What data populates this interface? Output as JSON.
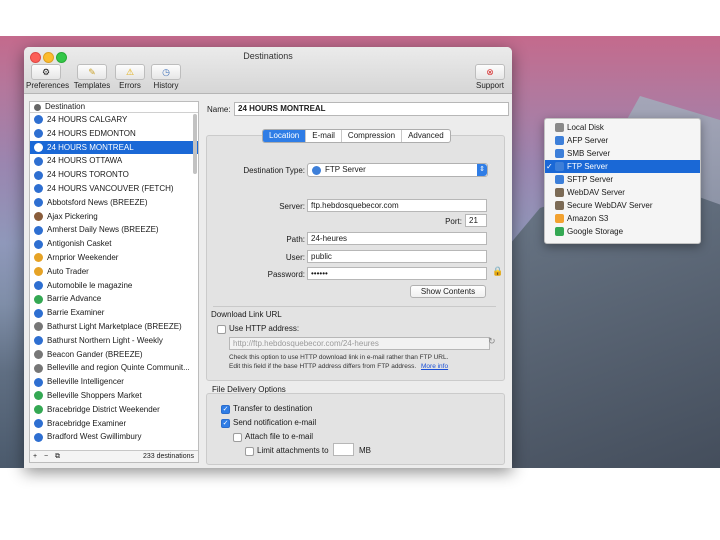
{
  "window": {
    "title": "Destinations"
  },
  "toolbar": {
    "preferences": "Preferences",
    "templates": "Templates",
    "errors": "Errors",
    "history": "History",
    "support": "Support"
  },
  "sidebar": {
    "header": "Destination",
    "items": [
      "24 HOURS CALGARY",
      "24 HOURS EDMONTON",
      "24 HOURS MONTREAL",
      "24 HOURS OTTAWA",
      "24 HOURS TORONTO",
      "24 HOURS VANCOUVER (FETCH)",
      "Abbotsford News (BREEZE)",
      "Ajax Pickering",
      "Amherst Daily News (BREEZE)",
      "Antigonish Casket",
      "Arnprior Weekender",
      "Auto Trader",
      "Automobile le magazine",
      "Barrie Advance",
      "Barrie Examiner",
      "Bathurst Light Marketplace (BREEZE)",
      "Bathurst Northern Light - Weekly",
      "Beacon Gander (BREEZE)",
      "Belleville and region Quinte Communit...",
      "Belleville Intelligencer",
      "Belleville Shoppers Market",
      "Bracebridge District Weekender",
      "Bracebridge Examiner",
      "Bradford West Gwillimbury"
    ],
    "count": "233 destinations",
    "add": "+",
    "remove": "−",
    "duplicate": "⧉"
  },
  "editor": {
    "name_label": "Name:",
    "name_value": "24 HOURS MONTREAL",
    "tabs": [
      "Location",
      "E-mail",
      "Compression",
      "Advanced"
    ],
    "dest_type_label": "Destination Type:",
    "dest_type_value": "FTP Server",
    "server_label": "Server:",
    "server_value": "ftp.hebdosquebecor.com",
    "port_label": "Port:",
    "port_value": "21",
    "path_label": "Path:",
    "path_value": "24-heures",
    "user_label": "User:",
    "user_value": "public",
    "password_label": "Password:",
    "password_value": "••••••",
    "show_contents": "Show Contents",
    "download_title": "Download Link URL",
    "use_http": "Use HTTP address:",
    "http_placeholder": "http://ftp.hebdosquebecor.com/24-heures",
    "help_line1": "Check this option to use HTTP download link in e-mail rather than FTP URL.",
    "help_line2": "Edit this field if the base HTTP address differs from FTP address.",
    "more_info": "More info",
    "fdo_title": "File Delivery Options",
    "transfer": "Transfer to destination",
    "send_notification": "Send notification e-mail",
    "attach_file": "Attach file to e-mail",
    "limit_attachments": "Limit attachments to",
    "mb": "MB"
  },
  "dest_menu": {
    "items": [
      {
        "label": "Local Disk",
        "color": "#8a8a8a"
      },
      {
        "label": "AFP Server",
        "color": "#3d7fd9"
      },
      {
        "label": "SMB Server",
        "color": "#3d7fd9"
      },
      {
        "label": "FTP Server",
        "color": "#3d7fd9"
      },
      {
        "label": "SFTP Server",
        "color": "#3d7fd9"
      },
      {
        "label": "WebDAV Server",
        "color": "#7b6a55"
      },
      {
        "label": "Secure WebDAV Server",
        "color": "#7b6a55"
      },
      {
        "label": "Amazon S3",
        "color": "#f2a12f"
      },
      {
        "label": "Google Storage",
        "color": "#34a853"
      }
    ],
    "selected_index": 3
  },
  "colors": {
    "accent": "#1a68d6"
  }
}
